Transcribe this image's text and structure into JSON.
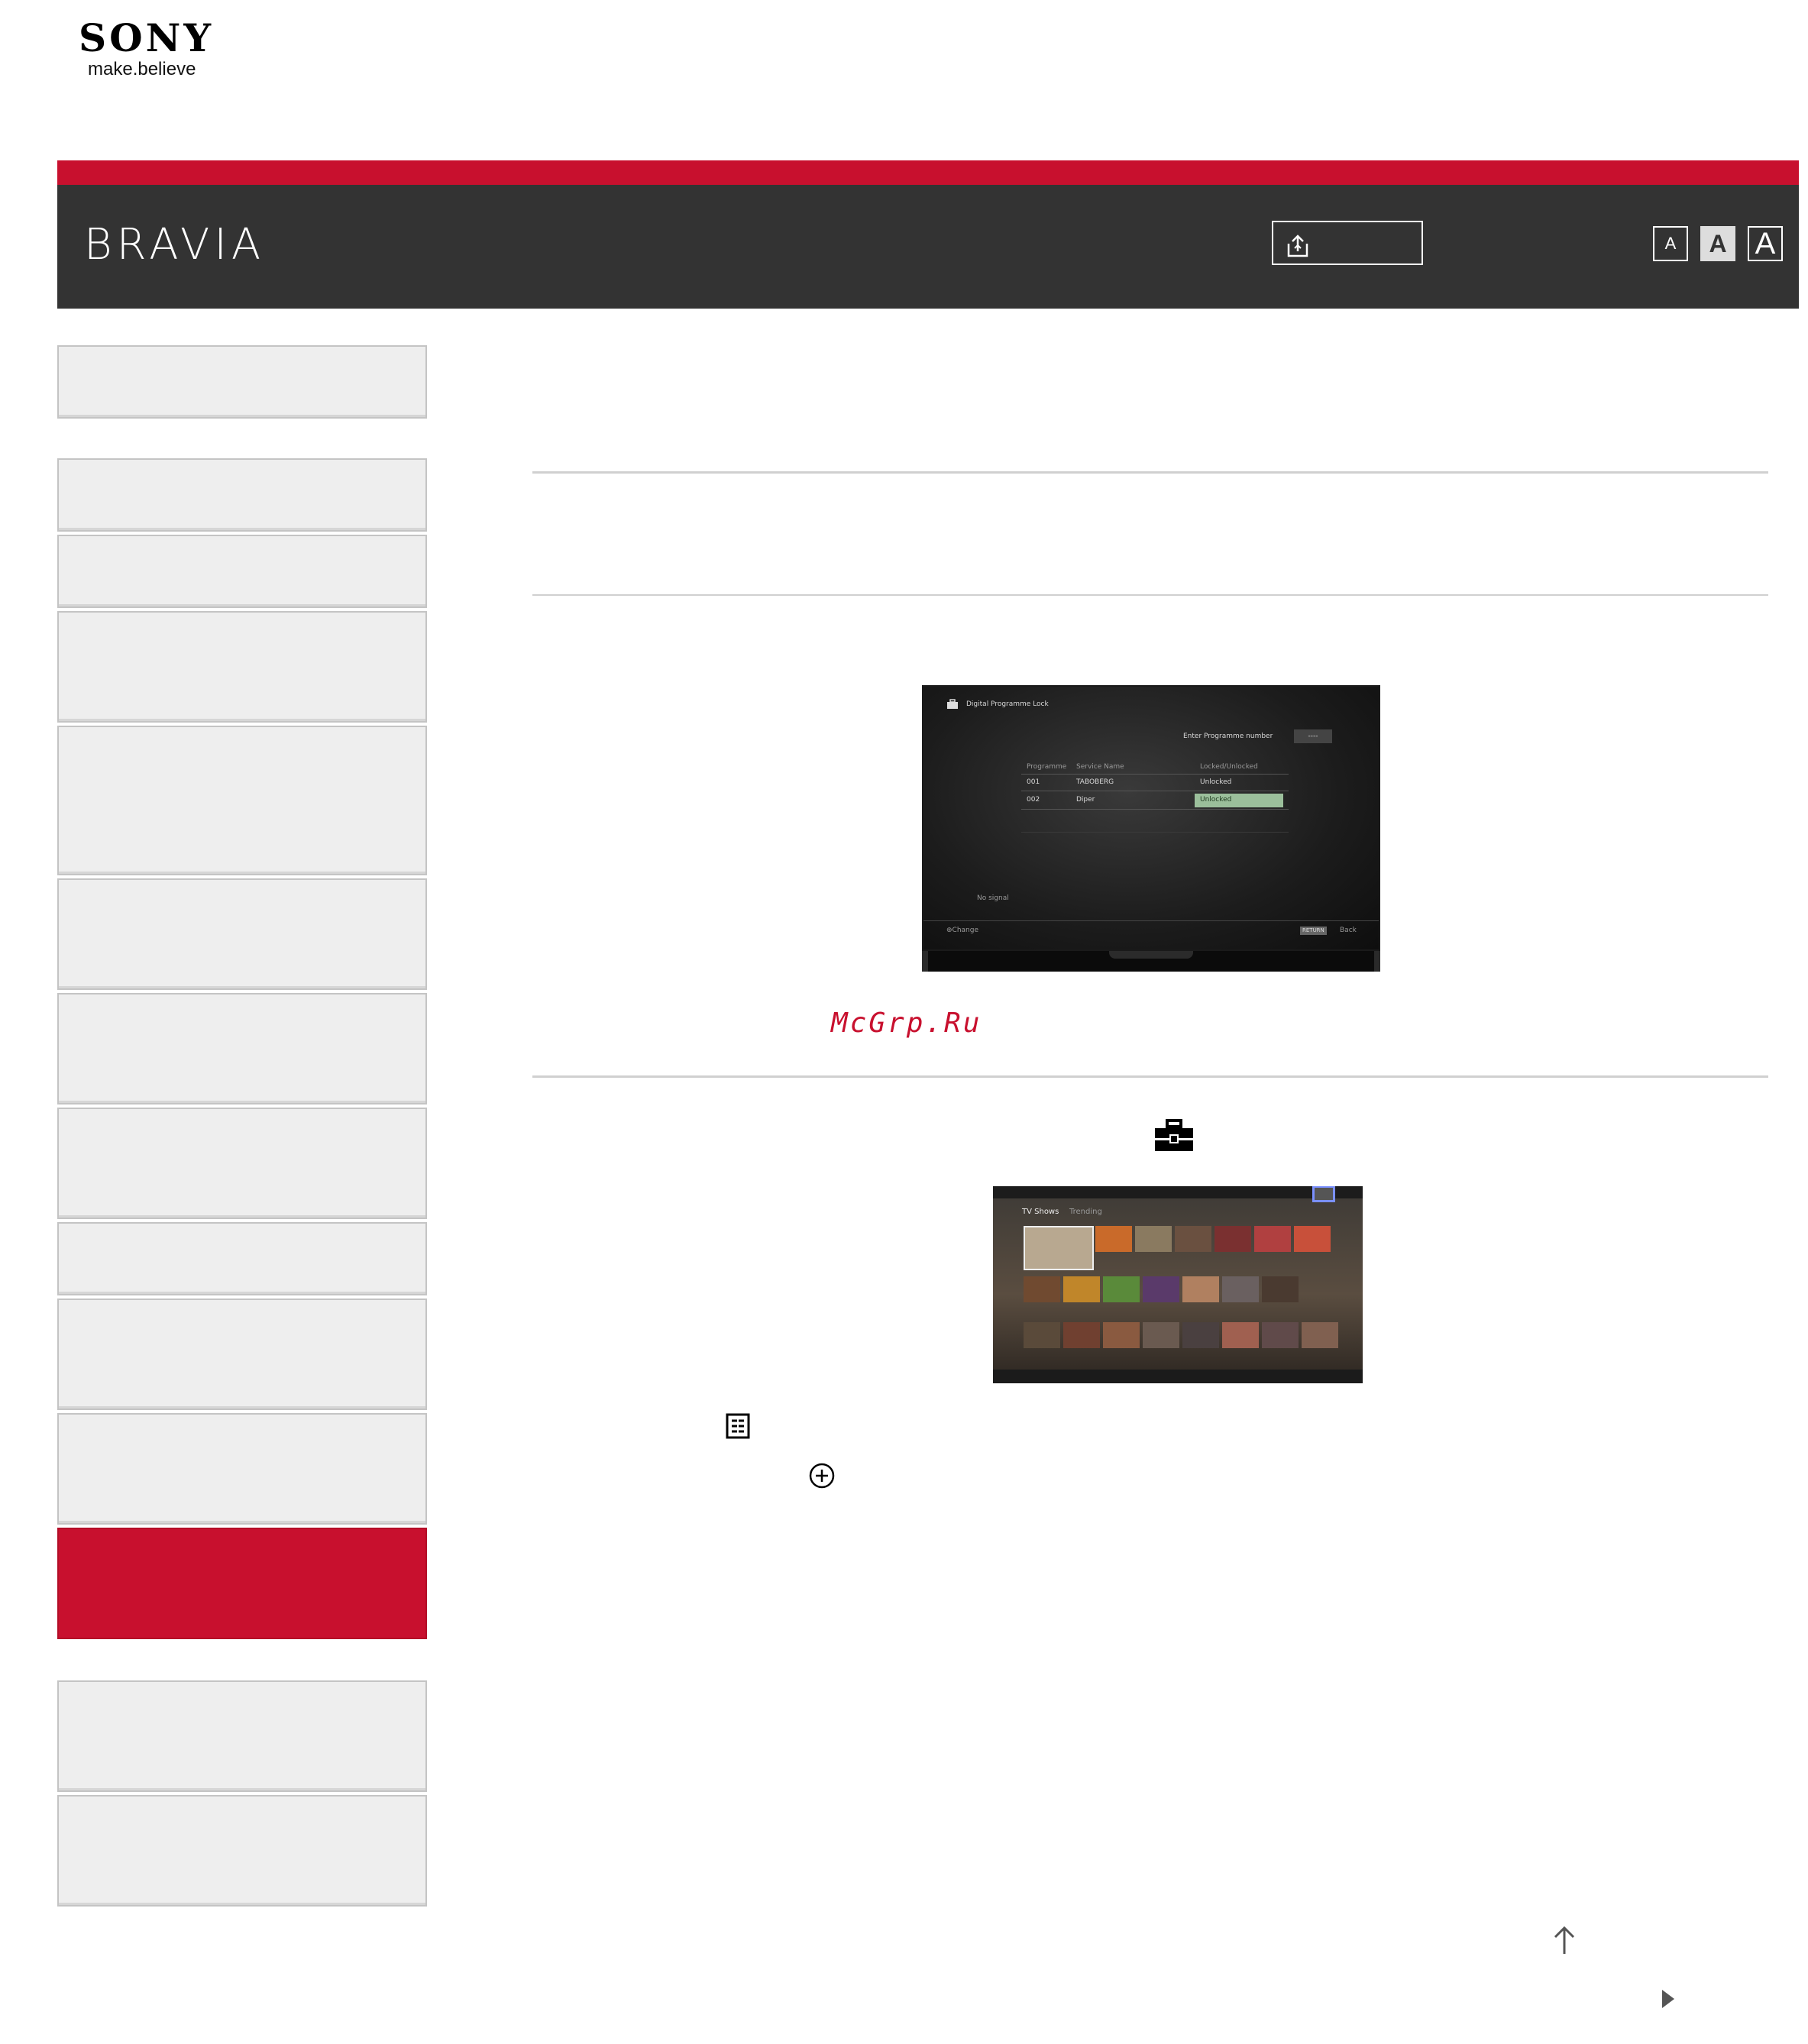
{
  "brand": {
    "wordmark": "SONY",
    "tagline": "make.believe",
    "product": "BRAVIA"
  },
  "header": {
    "share_icon": "share-upload-icon",
    "font_size_buttons": [
      {
        "label": "A",
        "size": "small",
        "selected": false
      },
      {
        "label": "A",
        "size": "medium",
        "selected": true
      },
      {
        "label": "A",
        "size": "large",
        "selected": false
      }
    ]
  },
  "colors": {
    "accent_red": "#c8102e",
    "header_dark": "#333333",
    "sidebar_bg": "#eeeeee"
  },
  "sidebar": {
    "active_index": 10,
    "item_count": 13
  },
  "tv_screen_1": {
    "title": "Digital Programme Lock",
    "enter_label": "Enter Programme number",
    "enter_value": "----",
    "columns": [
      "Programme",
      "Service Name",
      "Locked/Unlocked"
    ],
    "rows": [
      {
        "programme": "001",
        "service": "TABOBERG",
        "status": "Unlocked"
      },
      {
        "programme": "002",
        "service": "Diper",
        "status": "Unlocked"
      }
    ],
    "no_signal": "No signal",
    "footer_left": "Change",
    "footer_right_key": "RETURN",
    "footer_right": "Back"
  },
  "watermark": "McGrp.Ru",
  "icons": {
    "toolbox": "toolbox-icon",
    "options": "options-icon",
    "enter": "enter-circle-icon",
    "back_to_top": "arrow-up-icon",
    "next": "triangle-right-icon"
  },
  "tv_screen_2": {
    "tabs": [
      "TV Shows",
      "Trending"
    ]
  }
}
